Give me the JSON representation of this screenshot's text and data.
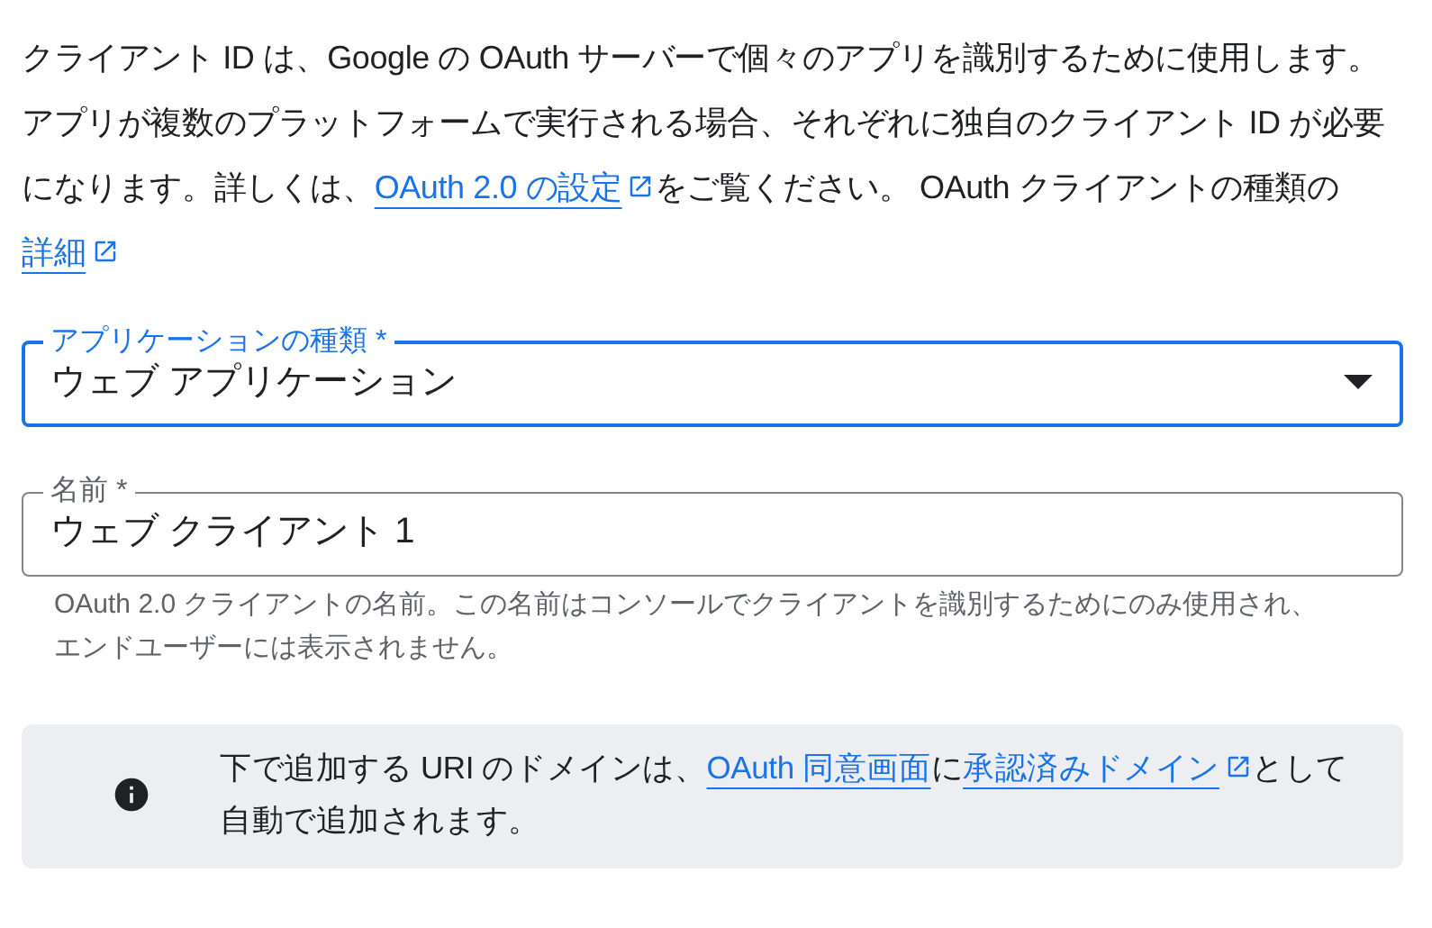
{
  "intro": {
    "parts": [
      {
        "kind": "text",
        "text": "クライアント ID は、Google の OAuth サーバーで個々のアプリを識別するために使用します。アプリが複数のプラットフォームで実行される場合、それぞれに独自のクライアント ID が必要になります。詳しくは、"
      },
      {
        "kind": "link",
        "text": "OAuth 2.0 の設定",
        "external": true
      },
      {
        "kind": "text",
        "text": "をご覧ください。 OAuth クライアントの種類の"
      },
      {
        "kind": "link",
        "text": "詳細",
        "external": true
      }
    ]
  },
  "fields": [
    {
      "kind": "select",
      "label": "アプリケーションの種類 *",
      "value": "ウェブ アプリケーション",
      "focused": true
    },
    {
      "kind": "text",
      "label": "名前 *",
      "value": "ウェブ クライアント 1",
      "focused": false,
      "helper": "OAuth 2.0 クライアントの名前。この名前はコンソールでクライアントを識別するためにのみ使用され、エンドユーザーには表示されません。"
    }
  ],
  "notice": {
    "parts": [
      {
        "kind": "text",
        "text": "下で追加する URI のドメインは、"
      },
      {
        "kind": "link",
        "text": "OAuth 同意画面",
        "external": false
      },
      {
        "kind": "text",
        "text": "に"
      },
      {
        "kind": "link",
        "text": "承認済みドメイン",
        "external": true
      },
      {
        "kind": "text",
        "text": "として自動で追加されます。"
      }
    ]
  }
}
